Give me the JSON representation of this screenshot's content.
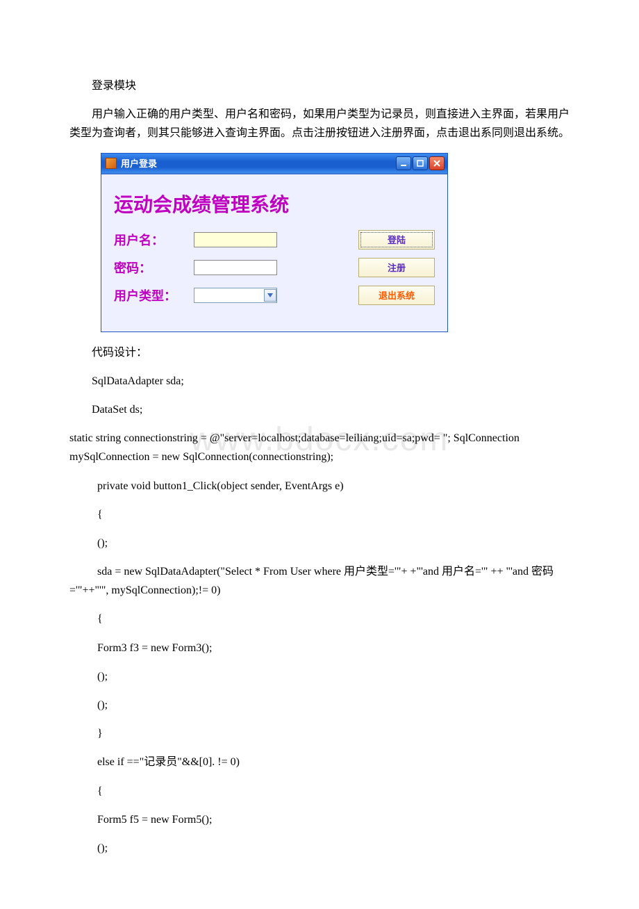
{
  "watermark": "www.bdocx.com",
  "doc": {
    "heading": " 登录模块",
    "intro": "用户输入正确的用户类型、用户名和密码，如果用户类型为记录员，则直接进入主界面，若果用户类型为查询者，则其只能够进入查询主界面。点击注册按钮进入注册界面，点击退出系同则退出系统。",
    "code_label": "代码设计：",
    "code_lines": [
      "SqlDataAdapter sda;",
      " DataSet ds;",
      "   static string connectionstring = @\"server=localhost;database=leiliang;uid=sa;pwd= \"; SqlConnection mySqlConnection = new SqlConnection(connectionstring);",
      "private void button1_Click(object sender, EventArgs e)",
      "{",
      " ();",
      "sda = new SqlDataAdapter(\"Select * From User where 用户类型='\"+ +\"'and 用户名='\" ++ \"'and 密码='\"++\"'\", mySqlConnection);!= 0)",
      " {",
      " Form3 f3 = new Form3();",
      " ();",
      "();",
      " }",
      "else if ==\"记录员\"&&[0]. != 0)",
      "{",
      " Form5 f5 = new Form5();",
      " ();"
    ]
  },
  "window": {
    "title": "用户登录",
    "app_title": "运动会成绩管理系统",
    "labels": {
      "username": "用户名：",
      "password": "密码：",
      "usertype": "用户类型："
    },
    "buttons": {
      "login": "登陆",
      "register": "注册",
      "exit": "退出系统"
    }
  }
}
